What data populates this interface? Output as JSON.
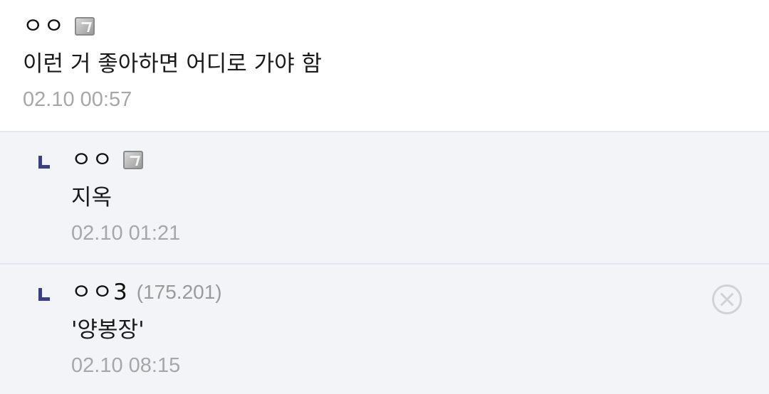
{
  "comments": [
    {
      "nick": "ㅇㅇ",
      "has_fixed_badge": true,
      "badge_icon": "fixed-nick-badge-icon",
      "text": "이런 거 좋아하면 어디로 가야 함",
      "time": "02.10 00:57"
    },
    {
      "nick": "ㅇㅇ",
      "has_fixed_badge": true,
      "badge_icon": "fixed-nick-badge-icon",
      "text": "지옥",
      "time": "02.10 01:21"
    },
    {
      "nick": "ㅇㅇ3",
      "ip": "(175.201)",
      "text": "'양봉장'",
      "time": "02.10 08:15",
      "action_icon": "delete-icon"
    }
  ],
  "colors": {
    "reply_background": "#f3f4f8",
    "reply_marker": "#3a3f80",
    "timestamp": "#a7a7a7",
    "divider": "#e3e6ee"
  }
}
